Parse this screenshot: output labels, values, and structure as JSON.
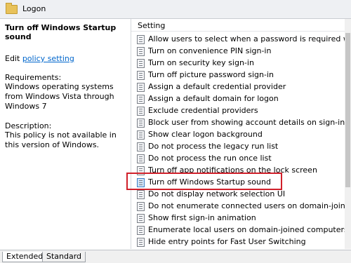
{
  "window": {
    "title": "Logon"
  },
  "left_pane": {
    "heading": "Turn off Windows Startup sound",
    "edit_prefix": "Edit",
    "edit_link": "policy setting",
    "requirements_label": "Requirements:",
    "requirements_text": "Windows operating systems from Windows Vista through Windows 7",
    "description_label": "Description:",
    "description_text": "This policy is not available in this version of Windows."
  },
  "list": {
    "column_header": "Setting",
    "rows": [
      "Allow users to select when a password is required when resu",
      "Turn on convenience PIN sign-in",
      "Turn on security key sign-in",
      "Turn off picture password sign-in",
      "Assign a default credential provider",
      "Assign a default domain for logon",
      "Exclude credential providers",
      "Block user from showing account details on sign-in",
      "Show clear logon background",
      "Do not process the legacy run list",
      "Do not process the run once list",
      "Turn off app notifications on the lock screen",
      "Turn off Windows Startup sound",
      "Do not display network selection UI",
      "Do not enumerate connected users on domain-joined comp",
      "Show first sign-in animation",
      "Enumerate local users on domain-joined computers",
      "Hide entry points for Fast User Switching"
    ],
    "selected_index": 12
  },
  "tabs": [
    "Extended",
    "Standard"
  ],
  "colors": {
    "highlight": "#d0202a",
    "link": "#0066cc"
  }
}
